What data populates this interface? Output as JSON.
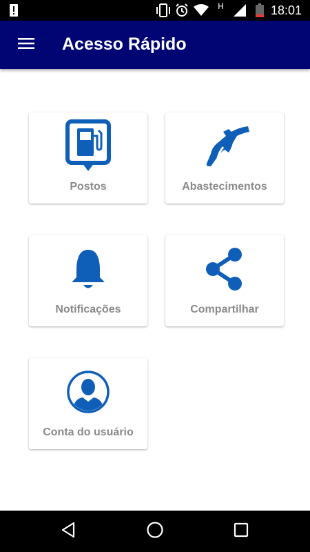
{
  "status_bar": {
    "time": "18:01",
    "network_indicator": "H",
    "icons": [
      "alert-icon",
      "vibrate-icon",
      "alarm-icon",
      "wifi-icon",
      "signal-icon",
      "battery-icon"
    ]
  },
  "app_bar": {
    "title": "Acesso Rápido",
    "menu_icon": "hamburger-menu-icon",
    "background_color": "#010573"
  },
  "quick_access": {
    "accent_color": "#0f5fb8",
    "items": [
      {
        "label": "Postos",
        "icon": "gas-station-pin-icon"
      },
      {
        "label": "Abastecimentos",
        "icon": "fuel-nozzle-icon"
      },
      {
        "label": "Notificações",
        "icon": "bell-icon"
      },
      {
        "label": "Compartilhar",
        "icon": "share-icon"
      },
      {
        "label": "Conta do usuário",
        "icon": "user-account-icon"
      }
    ]
  },
  "nav_bar": {
    "buttons": [
      "back-icon",
      "home-icon",
      "recents-icon"
    ]
  }
}
